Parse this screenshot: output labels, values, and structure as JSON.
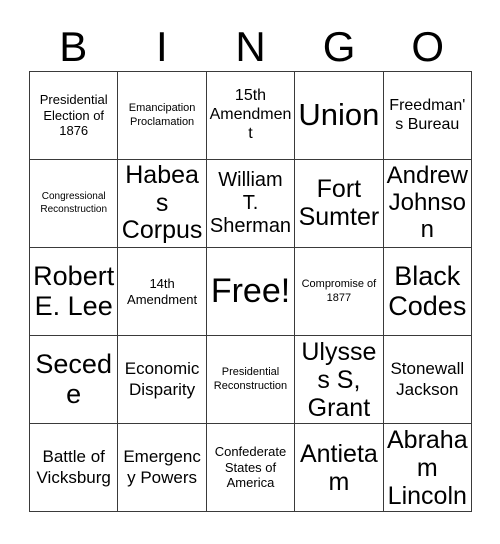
{
  "title": "BINGO Card",
  "header": {
    "letters": [
      "B",
      "I",
      "N",
      "G",
      "O"
    ]
  },
  "grid": {
    "columns": 5,
    "rows": 5,
    "free_space_index": 12,
    "border_color": "#3a3a3a",
    "background_color": "#ffffff",
    "text_color": "#000000",
    "cells": [
      {
        "text": "Presidential Election of 1876",
        "size": "s"
      },
      {
        "text": "Emancipation Proclamation",
        "size": "xs"
      },
      {
        "text": "15th Amendment",
        "size": "m"
      },
      {
        "text": "Union",
        "size": "h1"
      },
      {
        "text": "Freedman's Bureau",
        "size": "m"
      },
      {
        "text": "Congressional Reconstruction",
        "size": "xxs"
      },
      {
        "text": "Habeas Corpus",
        "size": "xxl"
      },
      {
        "text": "William T. Sherman",
        "size": "l"
      },
      {
        "text": "Fort Sumter",
        "size": "xxl"
      },
      {
        "text": "Andrew Johnson",
        "size": "xl"
      },
      {
        "text": "Robert E. Lee",
        "size": "xxl"
      },
      {
        "text": "14th Amendment",
        "size": "s"
      },
      {
        "text": "Free!",
        "size": "h2",
        "free": true
      },
      {
        "text": "Compromise of 1877",
        "size": "xs"
      },
      {
        "text": "Black Codes",
        "size": "xxl"
      },
      {
        "text": "Secede",
        "size": "xxl"
      },
      {
        "text": "Economic Disparity",
        "size": "ml"
      },
      {
        "text": "Presidential Reconstruction",
        "size": "xs"
      },
      {
        "text": "Ulysses S, Grant",
        "size": "xl"
      },
      {
        "text": "Stonewall Jackson",
        "size": "ml"
      },
      {
        "text": "Battle of Vicksburg",
        "size": "ml"
      },
      {
        "text": "Emergency Powers",
        "size": "ml"
      },
      {
        "text": "Confederate States of America",
        "size": "s"
      },
      {
        "text": "Antietam",
        "size": "xl"
      },
      {
        "text": "Abraham Lincoln",
        "size": "xl"
      }
    ]
  }
}
